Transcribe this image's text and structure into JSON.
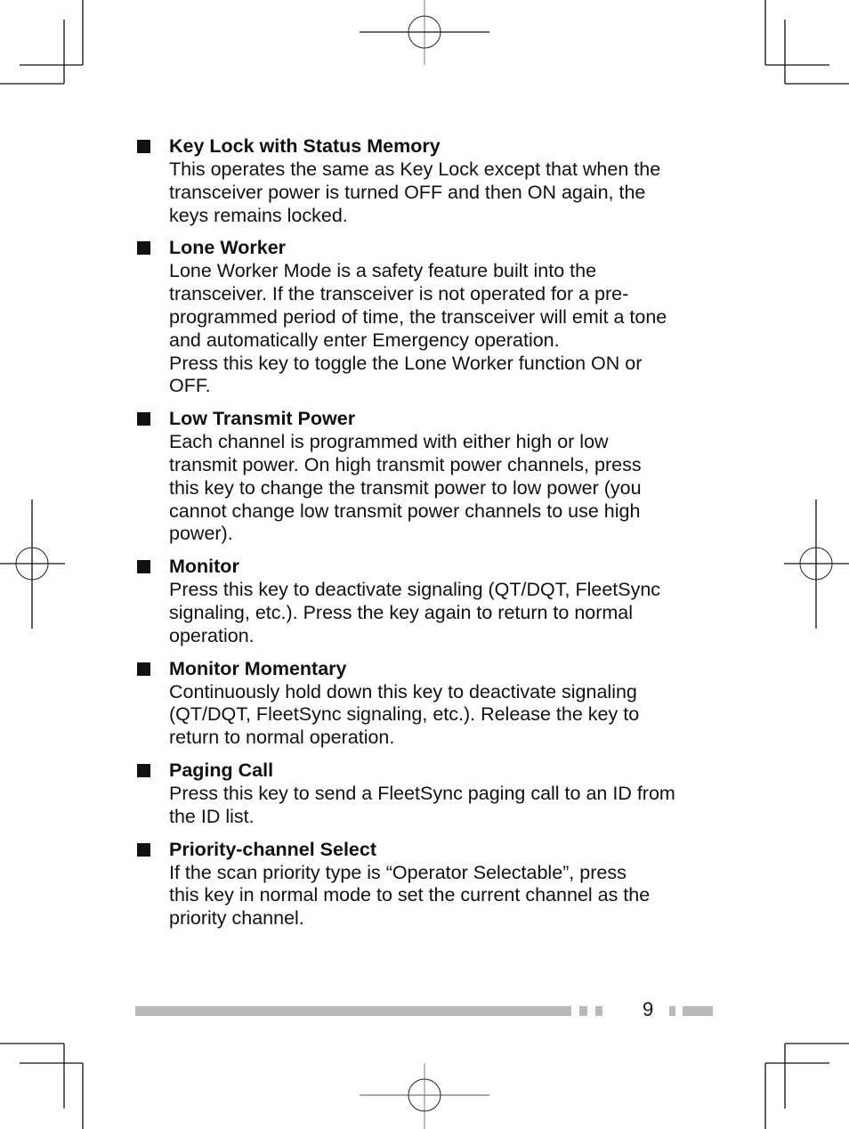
{
  "page_number": "9",
  "colors": {
    "text": "#111111",
    "footer_bar": "#b9b9b9"
  },
  "entries": [
    {
      "title": "Key Lock with Status Memory",
      "lines": [
        "This operates the same as Key Lock except that when the",
        "transceiver power is turned OFF and then ON again, the",
        "keys remains locked."
      ]
    },
    {
      "title": "Lone Worker",
      "lines": [
        "Lone Worker Mode is a safety feature built into the",
        "transceiver. If the transceiver is not operated for a pre-",
        "programmed period of time, the transceiver will emit a tone",
        "and automatically enter Emergency operation.",
        "Press this key to toggle the Lone Worker function ON or",
        "OFF."
      ]
    },
    {
      "title": "Low Transmit Power",
      "lines": [
        "Each channel is programmed with either high or low",
        "transmit power. On high transmit power channels, press",
        "this key to change the transmit power to low power (you",
        "cannot change low transmit power channels to use high",
        "power)."
      ]
    },
    {
      "title": "Monitor",
      "lines": [
        "Press this key to deactivate signaling (QT/DQT, FleetSync",
        "signaling, etc.). Press the key again to return to normal",
        "operation."
      ]
    },
    {
      "title": "Monitor Momentary",
      "lines": [
        "Continuously hold down this key to deactivate signaling",
        "(QT/DQT, FleetSync signaling, etc.). Release the key to",
        "return to normal operation."
      ]
    },
    {
      "title": "Paging Call",
      "lines": [
        "Press this key to send a FleetSync paging call to an ID from",
        "the ID list."
      ]
    },
    {
      "title": "Priority-channel Select",
      "lines": [
        "If the scan priority type is “Operator Selectable”, press",
        "this key in normal mode to set the current channel as the",
        "priority channel."
      ]
    }
  ]
}
